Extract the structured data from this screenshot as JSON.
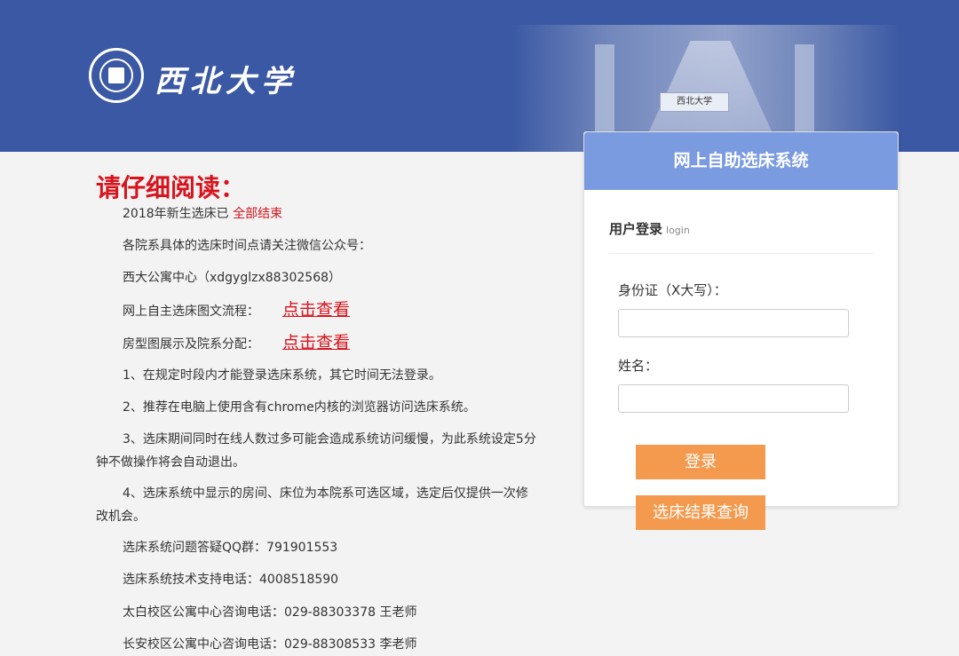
{
  "header": {
    "logo_text": "西北大学",
    "plaque_text": "西北大学"
  },
  "notice": {
    "title": "请仔细阅读：",
    "finished_prefix": "2018年新生选床已",
    "finished_status": "全部结束",
    "wechat_intro": "各院系具体的选床时间点请关注微信公众号：",
    "wechat_account": "西大公寓中心（xdgyglzx88302568）",
    "flow_label": "网上自主选床图文流程：",
    "flow_link": "点击查看",
    "room_label": "房型图展示及院系分配：",
    "room_link": "点击查看",
    "rule1": "1、在规定时段内才能登录选床系统，其它时间无法登录。",
    "rule2": "2、推荐在电脑上使用含有chrome内核的浏览器访问选床系统。",
    "rule3": "3、选床期间同时在线人数过多可能会造成系统访问缓慢，为此系统设定5分钟不做操作将会自动退出。",
    "rule4": "4、选床系统中显示的房间、床位为本院系可选区域，选定后仅提供一次修改机会。",
    "qq_group": "选床系统问题答疑QQ群：791901553",
    "support_phone": "选床系统技术支持电话：4008518590",
    "taibai_phone": "太白校区公寓中心咨询电话：029-88303378 王老师",
    "changan_phone": "长安校区公寓中心咨询电话：029-88308533 李老师"
  },
  "panel": {
    "title": "网上自助选床系统",
    "subtitle": "用户登录",
    "subtitle_en": "login",
    "id_label": "身份证（X大写）：",
    "id_value": "",
    "name_label": "姓名：",
    "name_value": "",
    "login_button": "登录",
    "query_button": "选床结果查询"
  },
  "colors": {
    "header_bg": "#3a58a3",
    "panel_header": "#7b9be0",
    "button": "#f39a4e",
    "alert_red": "#d8131b"
  }
}
